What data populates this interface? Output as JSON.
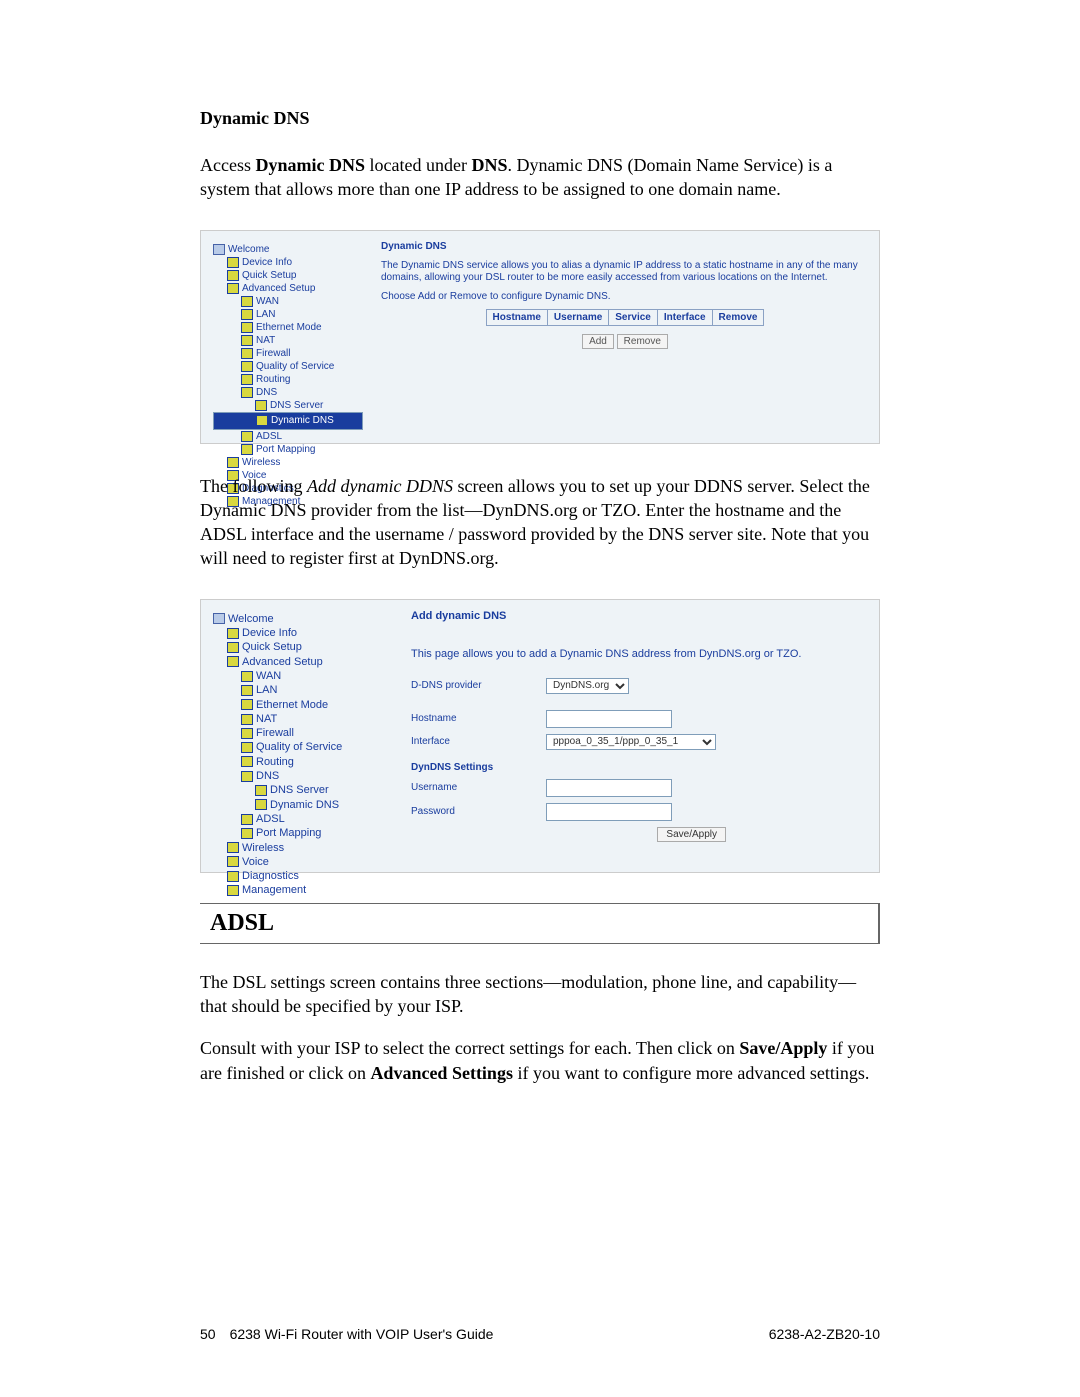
{
  "heading_ddns": "Dynamic DNS",
  "para1_a": "Access ",
  "para1_b": "Dynamic DNS",
  "para1_c": " located under ",
  "para1_d": "DNS",
  "para1_e": ". Dynamic DNS (Domain Name Service) is a system that allows more than one IP address to be assigned to one domain name.",
  "para2_a": "The following ",
  "para2_i": "Add dynamic DDNS",
  "para2_b": " screen allows you to set up your DDNS server. Select the Dynamic DNS provider from the list—DynDNS.org or TZO. Enter the hostname and the ADSL interface and the username / password provided by the DNS server site. Note that you will need to register first at DynDNS.org.",
  "tree": {
    "welcome": "Welcome",
    "device_info": "Device Info",
    "quick_setup": "Quick Setup",
    "advanced_setup": "Advanced Setup",
    "wan": "WAN",
    "lan": "LAN",
    "eth_mode": "Ethernet Mode",
    "nat": "NAT",
    "firewall": "Firewall",
    "qos": "Quality of Service",
    "routing": "Routing",
    "dns": "DNS",
    "dns_server": "DNS Server",
    "ddns": "Dynamic DNS",
    "adsl": "ADSL",
    "port_mapping": "Port Mapping",
    "wireless": "Wireless",
    "voice": "Voice",
    "diagnostics": "Diagnostics",
    "management": "Management"
  },
  "shot1": {
    "title": "Dynamic DNS",
    "desc": "The Dynamic DNS service allows you to alias a dynamic IP address to a static hostname in any of the many domains, allowing your DSL router to be more easily accessed from various locations on the Internet.",
    "hint": "Choose Add or Remove to configure Dynamic DNS.",
    "cols": [
      "Hostname",
      "Username",
      "Service",
      "Interface",
      "Remove"
    ],
    "btn_add": "Add",
    "btn_remove": "Remove"
  },
  "shot2": {
    "title": "Add dynamic DNS",
    "desc": "This page allows you to add a Dynamic DNS address from DynDNS.org or TZO.",
    "lbl_provider": "D-DNS provider",
    "lbl_hostname": "Hostname",
    "lbl_interface": "Interface",
    "sub": "DynDNS Settings",
    "lbl_user": "Username",
    "lbl_pass": "Password",
    "provider": "DynDNS.org",
    "interface": "pppoa_0_35_1/ppp_0_35_1",
    "btn_apply": "Save/Apply"
  },
  "heading_adsl": "ADSL",
  "para3": "The DSL settings screen contains three sections—modulation, phone line, and capability—that should be specified by your ISP.",
  "para4_a": "Consult with your ISP to select the correct settings for each. Then click on ",
  "para4_b": "Save/Apply",
  "para4_c": " if you are finished or click on ",
  "para4_d": "Advanced Settings",
  "para4_e": " if you want to configure more advanced settings.",
  "footer": {
    "page_no": "50",
    "guide": "6238 Wi-Fi Router with VOIP User's Guide",
    "docid": "6238-A2-ZB20-10"
  }
}
